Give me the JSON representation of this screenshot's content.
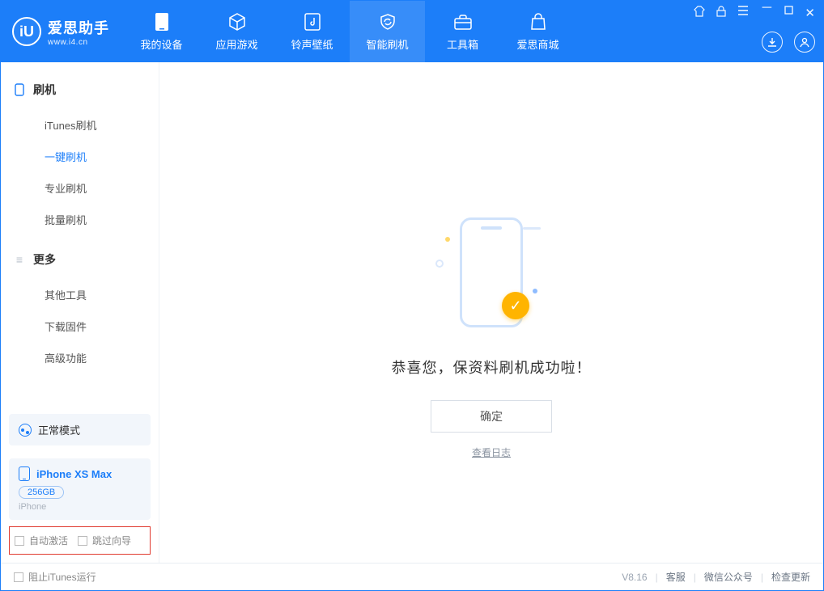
{
  "brand": {
    "name": "爱思助手",
    "url": "www.i4.cn"
  },
  "nav": {
    "items": [
      {
        "label": "我的设备"
      },
      {
        "label": "应用游戏"
      },
      {
        "label": "铃声壁纸"
      },
      {
        "label": "智能刷机"
      },
      {
        "label": "工具箱"
      },
      {
        "label": "爱思商城"
      }
    ]
  },
  "sidebar": {
    "group1": {
      "title": "刷机",
      "items": [
        "iTunes刷机",
        "一键刷机",
        "专业刷机",
        "批量刷机"
      ]
    },
    "group2": {
      "title": "更多",
      "items": [
        "其他工具",
        "下载固件",
        "高级功能"
      ]
    },
    "mode": {
      "label": "正常模式"
    },
    "device": {
      "name": "iPhone XS Max",
      "capacity": "256GB",
      "subtitle": "iPhone"
    },
    "opts": {
      "autoActivate": "自动激活",
      "skipGuide": "跳过向导"
    }
  },
  "main": {
    "success": "恭喜您，保资料刷机成功啦！",
    "ok": "确定",
    "viewLog": "查看日志"
  },
  "status": {
    "blockItunes": "阻止iTunes运行",
    "version": "V8.16",
    "links": [
      "客服",
      "微信公众号",
      "检查更新"
    ]
  }
}
